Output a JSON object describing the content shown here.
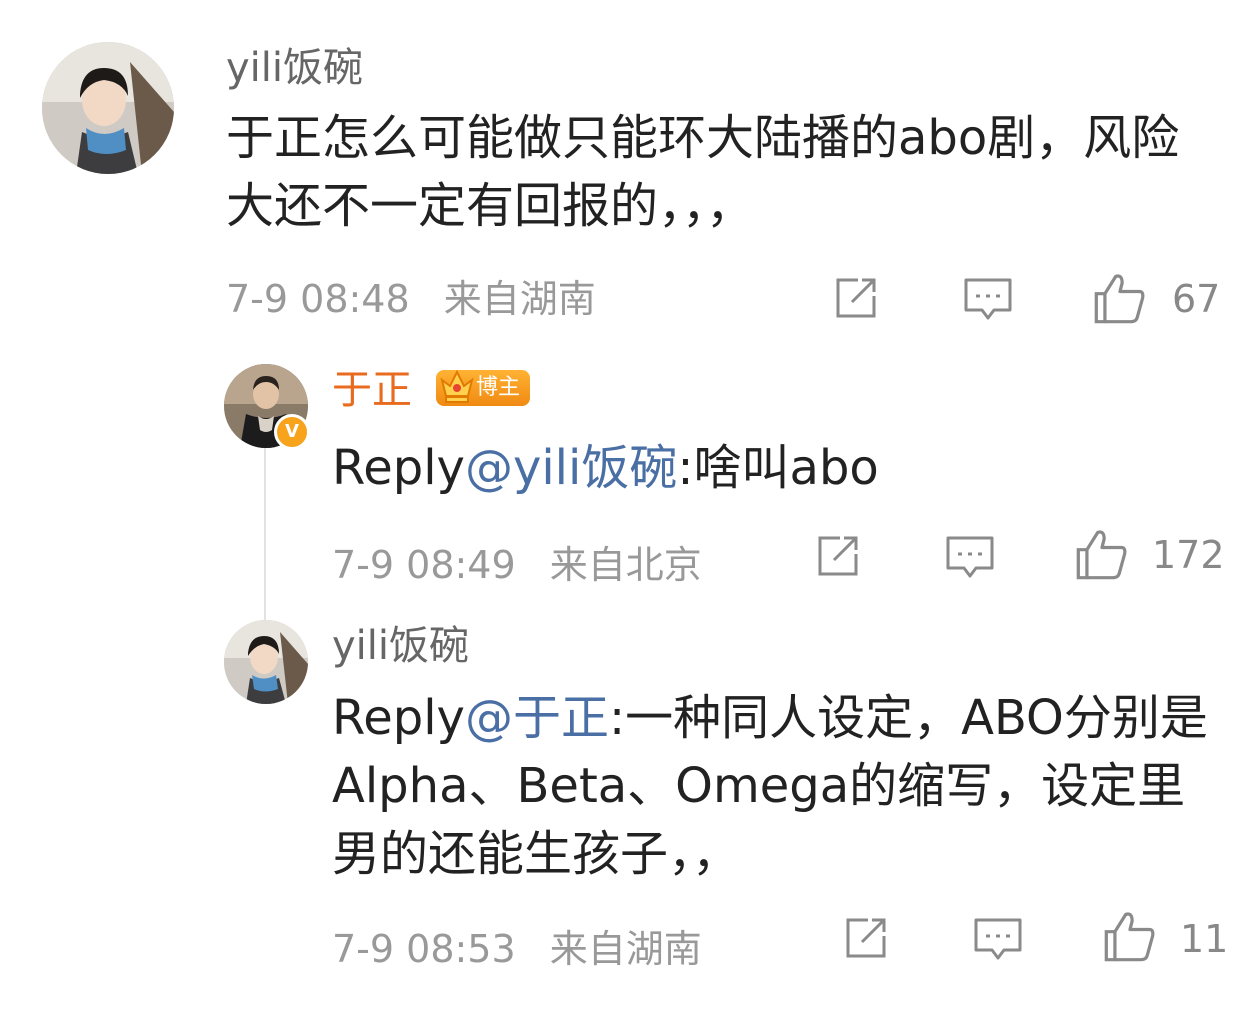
{
  "comments": [
    {
      "username": "yili饭碗",
      "text": "于正怎么可能做只能环大陆播的abo剧，风险大还不一定有回报的，，，",
      "time": "7-9 08:48",
      "location": "来自湖南",
      "likes": "67"
    },
    {
      "username": "于正",
      "badge": "博主",
      "reply_prefix": "Reply",
      "mention": "@yili饭碗",
      "text": ":啥叫abo",
      "time": "7-9 08:49",
      "location": "来自北京",
      "likes": "172"
    },
    {
      "username": "yili饭碗",
      "reply_prefix": "Reply",
      "mention": "@于正",
      "text": ":一种同人设定，ABO分别是Alpha、Beta、Omega的缩写，设定里男的还能生孩子，，",
      "time": "7-9 08:53",
      "location": "来自湖南",
      "likes": "11"
    }
  ],
  "icons": {
    "share": "share-icon",
    "comment": "comment-icon",
    "like": "thumbs-up-icon",
    "verified": "verified-icon",
    "badge": "crown-icon"
  },
  "colors": {
    "mention": "#4a6fa5",
    "blogger_name": "#e86b1f",
    "meta": "#999999",
    "badge": "#f08a12"
  }
}
